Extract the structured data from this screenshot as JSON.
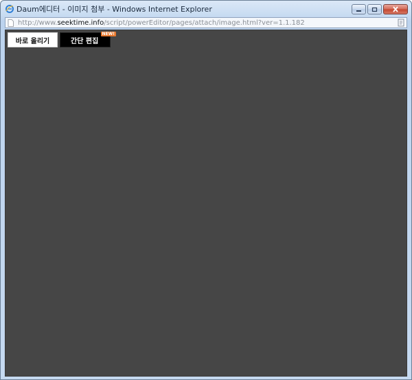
{
  "window": {
    "title": "Daum에디터 - 이미지 첨부 - Windows Internet Explorer",
    "icon": "ie-icon",
    "controls": {
      "minimize": "minimize-icon",
      "maximize": "maximize-icon",
      "close": "close-icon"
    }
  },
  "address": {
    "url_prefix": "http://www.",
    "url_domain": "seektime.info",
    "url_path": "/script/powerEditor/pages/attach/image.html?ver=1.1.182",
    "left_icon": "page-icon",
    "right_icon": "compat-view-icon"
  },
  "tabs": [
    {
      "label": "바로 올리기",
      "active": true
    },
    {
      "label": "간단 편집",
      "badge": "NEW!"
    }
  ],
  "colors": {
    "content_bg": "#464646",
    "tab_active_bg": "#ffffff",
    "tab_dark_bg": "#000000",
    "badge": "#e8782d"
  }
}
